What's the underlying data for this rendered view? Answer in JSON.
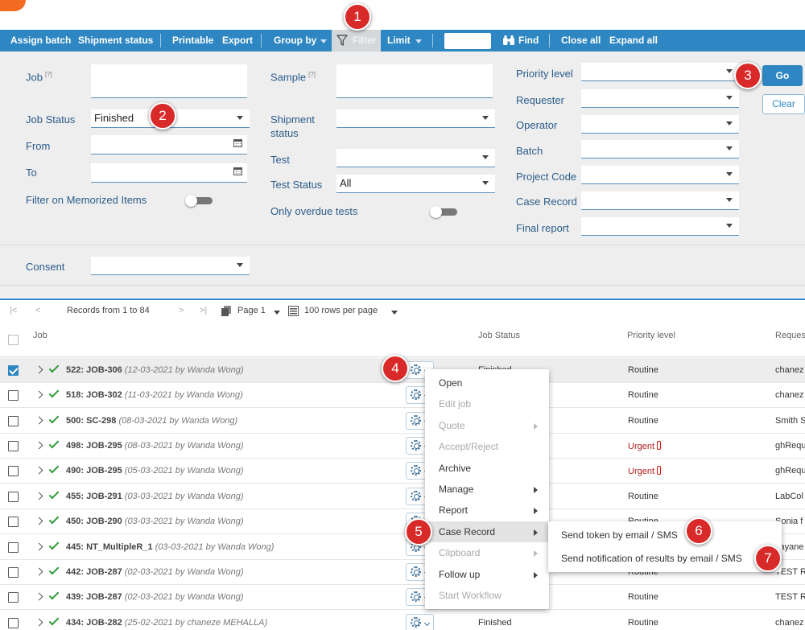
{
  "topbar": {
    "subtitle": ""
  },
  "toolbar": {
    "assign_batch": "Assign batch",
    "shipment_status": "Shipment status",
    "printable": "Printable",
    "export": "Export",
    "group_by": "Group by",
    "filter": "Filter",
    "limit": "Limit",
    "find_value": "",
    "find": "Find",
    "close_all": "Close all",
    "expand_all": "Expand all"
  },
  "filters": {
    "job_label": "Job",
    "job_status_label": "Job Status",
    "job_status_value": "Finished",
    "from_label": "From",
    "to_label": "To",
    "memorized_label": "Filter on Memorized Items",
    "sample_label": "Sample",
    "shipment_status_label_1": "Shipment",
    "shipment_status_label_2": "status",
    "test_label": "Test",
    "test_status_label": "Test Status",
    "test_status_value": "All",
    "overdue_label": "Only overdue tests",
    "priority_label": "Priority level",
    "requester_label": "Requester",
    "operator_label": "Operator",
    "batch_label": "Batch",
    "project_code_label": "Project Code",
    "case_record_label": "Case Record",
    "final_report_label": "Final report",
    "consent_label": "Consent",
    "help_marker": "[?]",
    "go": "Go",
    "clear": "Clear"
  },
  "pager": {
    "records": "Records from 1 to 84",
    "page": "Page 1",
    "rows_per_page": "100 rows per page"
  },
  "grid": {
    "col_job": "Job",
    "col_status": "Job Status",
    "col_priority": "Priority level",
    "col_requester": "Reques",
    "rows": [
      {
        "id": "522: JOB-306",
        "meta": "(12-03-2021 by Wanda Wong)",
        "status": "Finished",
        "priority": "Routine",
        "requester": "chanez",
        "selected": true
      },
      {
        "id": "518: JOB-302",
        "meta": "(11-03-2021 by Wanda Wong)",
        "status": "",
        "priority": "Routine",
        "requester": "chanez",
        "selected": false
      },
      {
        "id": "500: SC-298",
        "meta": "(08-03-2021 by Wanda Wong)",
        "status": "",
        "priority": "Routine",
        "requester": "Smith S",
        "selected": false
      },
      {
        "id": "498: JOB-295",
        "meta": "(08-03-2021 by Wanda Wong)",
        "status": "",
        "priority": "Urgent",
        "requester": "ghRequ",
        "selected": false
      },
      {
        "id": "490: JOB-295",
        "meta": "(05-03-2021 by Wanda Wong)",
        "status": "",
        "priority": "Urgent",
        "requester": "ghRequ",
        "selected": false
      },
      {
        "id": "455: JOB-291",
        "meta": "(03-03-2021 by Wanda Wong)",
        "status": "",
        "priority": "Routine",
        "requester": "LabCol",
        "selected": false
      },
      {
        "id": "450: JOB-290",
        "meta": "(03-03-2021 by Wanda Wong)",
        "status": "",
        "priority": "Routine",
        "requester": "Sonia f",
        "selected": false
      },
      {
        "id": "445: NT_MultipleR_1",
        "meta": "(03-03-2021 by Wanda Wong)",
        "status": "",
        "priority": "",
        "requester": "Jayane",
        "selected": false
      },
      {
        "id": "442: JOB-287",
        "meta": "(02-03-2021 by Wanda Wong)",
        "status": "",
        "priority": "Routine",
        "requester": "TEST RE",
        "selected": false
      },
      {
        "id": "439: JOB-287",
        "meta": "(02-03-2021 by Wanda Wong)",
        "status": "",
        "priority": "Routine",
        "requester": "TEST RE",
        "selected": false
      },
      {
        "id": "434: JOB-282",
        "meta": "(25-02-2021 by chaneze MEHALLA)",
        "status": "Finished",
        "priority": "Routine",
        "requester": "chanez",
        "selected": false
      }
    ]
  },
  "context_menu": {
    "items": [
      {
        "label": "Open",
        "disabled": false,
        "submenu": false
      },
      {
        "label": "Edit job",
        "disabled": true,
        "submenu": false
      },
      {
        "label": "Quote",
        "disabled": true,
        "submenu": true
      },
      {
        "label": "Accept/Reject",
        "disabled": true,
        "submenu": false
      },
      {
        "label": "Archive",
        "disabled": false,
        "submenu": false
      },
      {
        "label": "Manage",
        "disabled": false,
        "submenu": true
      },
      {
        "label": "Report",
        "disabled": false,
        "submenu": true
      },
      {
        "label": "Case Record",
        "disabled": false,
        "submenu": true,
        "highlighted": true
      },
      {
        "label": "Clipboard",
        "disabled": true,
        "submenu": true
      },
      {
        "label": "Follow up",
        "disabled": false,
        "submenu": true
      },
      {
        "label": "Start Workflow",
        "disabled": true,
        "submenu": false
      }
    ]
  },
  "submenu": {
    "send_token": "Send token by email / SMS",
    "send_notification": "Send notification of results by email / SMS"
  },
  "badges": [
    "1",
    "2",
    "3",
    "4",
    "5",
    "6",
    "7"
  ],
  "colors": {
    "accent": "#2e87c2",
    "badge": "#d92a2a",
    "logo": "#f26b21",
    "ok": "#2e9b3a",
    "urgent": "#b01e1e"
  }
}
